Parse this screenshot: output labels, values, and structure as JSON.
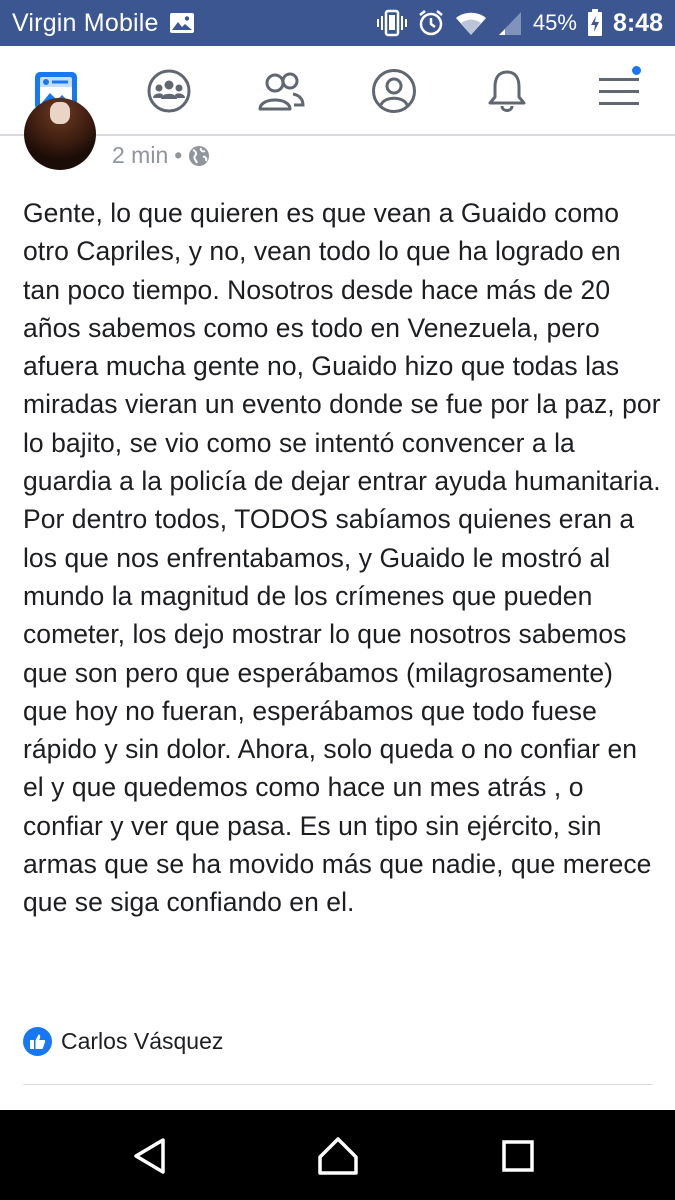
{
  "status_bar": {
    "carrier": "Virgin Mobile",
    "battery": "45%",
    "time": "8:48",
    "icons": [
      "image-icon",
      "vibrate-icon",
      "alarm-icon",
      "wifi-icon",
      "signal-icon",
      "battery-icon"
    ]
  },
  "nav": {
    "items": [
      "news-feed-icon",
      "groups-icon",
      "friends-icon",
      "profile-icon",
      "notifications-icon",
      "menu-icon"
    ],
    "accent_color": "#1877f2"
  },
  "post": {
    "time": "2 min",
    "separator": "•",
    "privacy_icon": "globe-icon",
    "text": "Gente, lo que quieren es que vean a Guaido como otro Capriles, y no, vean todo lo que ha logrado en tan poco tiempo. Nosotros desde hace más de 20 años sabemos como es todo en Venezuela, pero afuera mucha gente no, Guaido hizo que todas las miradas vieran un evento donde se fue por la paz, por lo bajito, se vio como se intentó convencer a la guardia a la policía de dejar entrar ayuda humanitaria. Por dentro todos, TODOS sabíamos quienes eran a los que nos enfrentabamos, y Guaido le mostró al mundo la magnitud de los crímenes que pueden cometer, los dejo mostrar lo que nosotros sabemos que son pero que esperábamos (milagrosamente) que hoy no fueran, esperábamos que todo fuese rápido y sin dolor. Ahora, solo queda o no confiar en el y que quedemos como hace un mes atrás , o confiar y ver que pasa. Es un tipo sin ejército, sin armas que se ha movido más que nadie, que merece que se siga confiando en el.",
    "reactor": "Carlos Vásquez"
  },
  "android_nav": [
    "back-icon",
    "home-icon",
    "recents-icon"
  ]
}
